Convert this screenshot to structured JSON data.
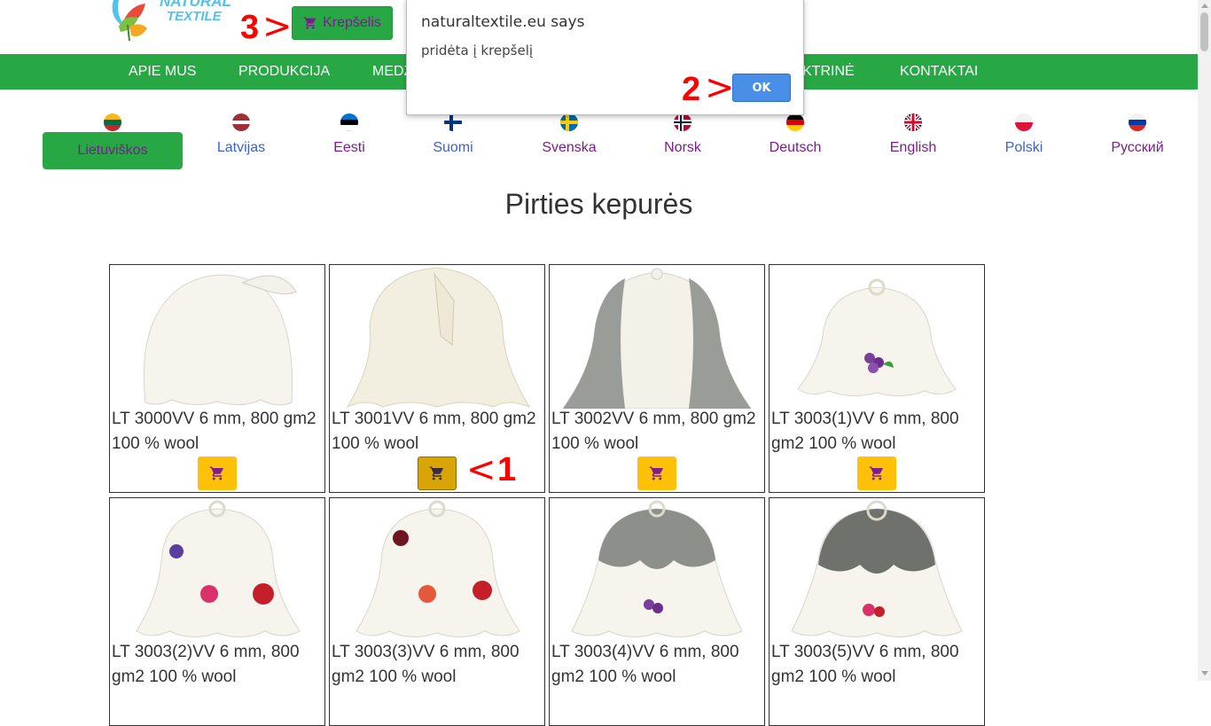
{
  "header": {
    "logo_line1": "NATURAL",
    "logo_line2": "TEXTILE",
    "cart_label": "Krepšelis"
  },
  "nav": {
    "items": [
      "APIE MUS",
      "PRODUKCIJA",
      "MEDŽ",
      "KTRINĖ",
      "KONTAKTAI"
    ]
  },
  "languages": {
    "active": "Lietuviškos",
    "items": [
      "Latvijas",
      "Eesti",
      "Suomi",
      "Svenska",
      "Norsk",
      "Deutsch",
      "English",
      "Polski",
      "Русский"
    ]
  },
  "page": {
    "title": "Pirties kepurės"
  },
  "products": [
    {
      "line1": "LT 3000VV 6 mm, 800 gm2",
      "line2": "100 % wool"
    },
    {
      "line1": "LT 3001VV 6 mm, 800 gm2",
      "line2": "100 % wool"
    },
    {
      "line1": "LT 3002VV 6 mm, 800 gm2",
      "line2": "100 % wool"
    },
    {
      "line1": "LT 3003(1)VV 6 mm, 800",
      "line2": "gm2 100 % wool"
    },
    {
      "line1": "LT 3003(2)VV 6 mm, 800",
      "line2": "gm2 100 % wool"
    },
    {
      "line1": "LT 3003(3)VV 6 mm, 800",
      "line2": "gm2 100 % wool"
    },
    {
      "line1": "LT 3003(4)VV 6 mm, 800",
      "line2": "gm2 100 % wool"
    },
    {
      "line1": "LT 3003(5)VV 6 mm, 800",
      "line2": "gm2 100 % wool"
    }
  ],
  "dialog": {
    "title": "naturaltextile.eu says",
    "message": "pridėta į krepšelį",
    "ok_label": "OK"
  },
  "annotations": {
    "a1": "1",
    "a2": "2",
    "a3": "3",
    "arrow_right": ">",
    "arrow_left": "<"
  },
  "colors": {
    "brand_green": "#28a745",
    "cart_yellow": "#ffc107",
    "link_purple": "#7b1c8f",
    "link_blue": "#3a62c9",
    "annotation_red": "#ff0000"
  }
}
